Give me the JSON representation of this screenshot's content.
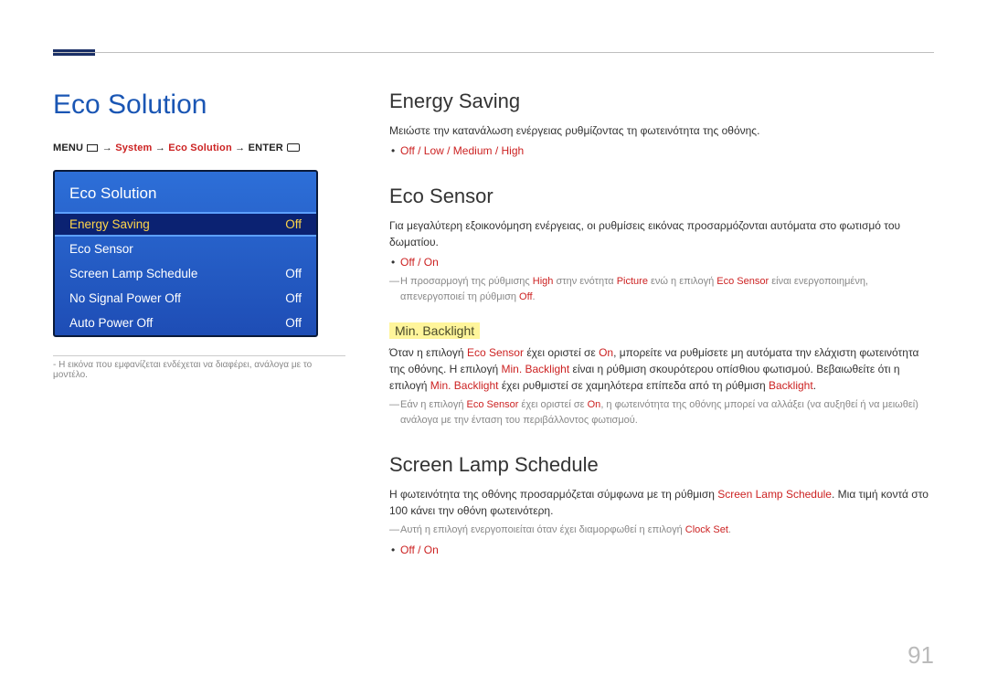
{
  "header": {
    "section_title": "Eco Solution",
    "menu_path_prefix": "MENU",
    "menu_path_sep": " → ",
    "menu_path_item1": "System",
    "menu_path_item2": "Eco Solution",
    "menu_path_suffix": "ENTER"
  },
  "panel": {
    "title": "Eco Solution",
    "rows": [
      {
        "label": "Energy Saving",
        "value": "Off",
        "selected": true
      },
      {
        "label": "Eco Sensor",
        "value": "",
        "selected": false
      },
      {
        "label": "Screen Lamp Schedule",
        "value": "Off",
        "selected": false
      },
      {
        "label": "No Signal Power Off",
        "value": "Off",
        "selected": false
      },
      {
        "label": "Auto Power Off",
        "value": "Off",
        "selected": false
      }
    ]
  },
  "image_note": "Η εικόνα που εμφανίζεται ενδέχεται να διαφέρει, ανάλογα με το μοντέλο.",
  "energy_saving": {
    "heading": "Energy Saving",
    "body": "Μειώστε την κατανάλωση ενέργειας ρυθμίζοντας τη φωτεινότητα της οθόνης.",
    "options": "Off / Low / Medium / High"
  },
  "eco_sensor": {
    "heading": "Eco Sensor",
    "body": "Για μεγαλύτερη εξοικονόμηση ενέργειας, οι ρυθμίσεις εικόνας προσαρμόζονται αυτόματα στο φωτισμό του δωματίου.",
    "options": "Off / On",
    "note_pre": "Η προσαρμογή της ρύθμισης ",
    "note_high": "High",
    "note_mid1": " στην ενότητα ",
    "note_picture": "Picture",
    "note_mid2": " ενώ η επιλογή ",
    "note_ecos": "Eco Sensor",
    "note_mid3": " είναι ενεργοποιημένη, απενεργοποιεί τη ρύθμιση ",
    "note_off": "Off",
    "note_tail": "."
  },
  "min_backlight": {
    "subheading": "Min. Backlight",
    "body_pre": "Όταν η επιλογή ",
    "body_ecos": "Eco Sensor",
    "body_mid1": " έχει οριστεί σε ",
    "body_on": "On",
    "body_mid2": ", μπορείτε να ρυθμίσετε μη αυτόματα την ελάχιστη φωτεινότητα της οθόνης. Η επιλογή ",
    "body_mb": "Min. Backlight",
    "body_mid3": " είναι η ρύθμιση σκουρότερου οπίσθιου φωτισμού. Βεβαιωθείτε ότι η επιλογή ",
    "body_mb2": "Min. Backlight",
    "body_mid4": " έχει ρυθμιστεί σε χαμηλότερα επίπεδα από τη ρύθμιση ",
    "body_bl": "Backlight",
    "body_tail": ".",
    "note_pre": "Εάν η επιλογή ",
    "note_ecos": "Eco Sensor",
    "note_mid1": " έχει οριστεί σε ",
    "note_on": "On",
    "note_tail": ", η φωτεινότητα της οθόνης μπορεί να αλλάξει (να αυξηθεί ή να μειωθεί) ανάλογα με την ένταση του περιβάλλοντος φωτισμού."
  },
  "screen_lamp": {
    "heading": "Screen Lamp Schedule",
    "body_pre": "Η φωτεινότητα της οθόνης προσαρμόζεται σύμφωνα με τη ρύθμιση ",
    "body_sls": "Screen Lamp Schedule",
    "body_tail": ". Μια τιμή κοντά στο 100 κάνει την οθόνη φωτεινότερη.",
    "note_pre": "Αυτή η επιλογή ενεργοποιείται όταν έχει διαμορφωθεί η επιλογή ",
    "note_clock": "Clock Set",
    "note_tail": ".",
    "options": "Off / On"
  },
  "page_number": "91"
}
